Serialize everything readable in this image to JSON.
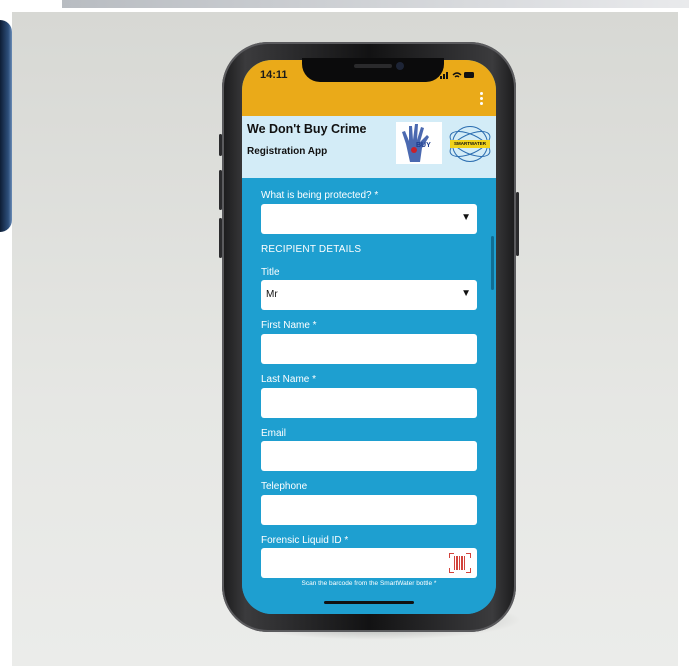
{
  "status_bar": {
    "time": "14:11",
    "icons": "signal-wifi-battery"
  },
  "header": {
    "title": "We Don't Buy Crime",
    "subtitle": "Registration App",
    "logo_left_text": "BUY",
    "logo_right_text": "SMARTWATER"
  },
  "form": {
    "protected_label": "What is being protected? *",
    "protected_value": "",
    "section_recipient": "RECIPIENT DETAILS",
    "title_label": "Title",
    "title_value": "Mr",
    "first_name_label": "First Name *",
    "last_name_label": "Last Name *",
    "email_label": "Email",
    "telephone_label": "Telephone",
    "liquid_id_label": "Forensic Liquid ID *",
    "scan_hint": "Scan the barcode from the SmartWater bottle *"
  },
  "colors": {
    "status_bar": "#eaaa19",
    "header_bg": "#d3ecf7",
    "form_bg": "#1e9fd0",
    "scan_icon": "#d2433b"
  }
}
